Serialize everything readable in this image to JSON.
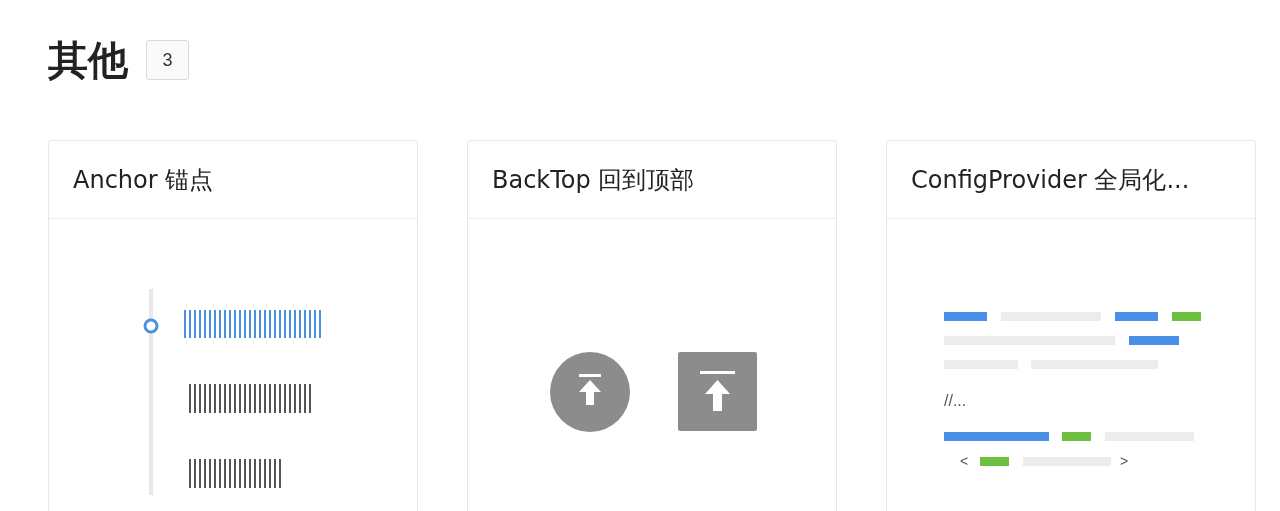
{
  "section": {
    "title": "其他",
    "count": "3"
  },
  "cards": [
    {
      "kind": "anchor",
      "title": "Anchor 锚点"
    },
    {
      "kind": "backtop",
      "title": "BackTop 回到顶部"
    },
    {
      "kind": "config",
      "title": "ConfigProvider 全局化...",
      "comment": "//...",
      "open_bracket": "<",
      "close_bracket": ">"
    }
  ]
}
